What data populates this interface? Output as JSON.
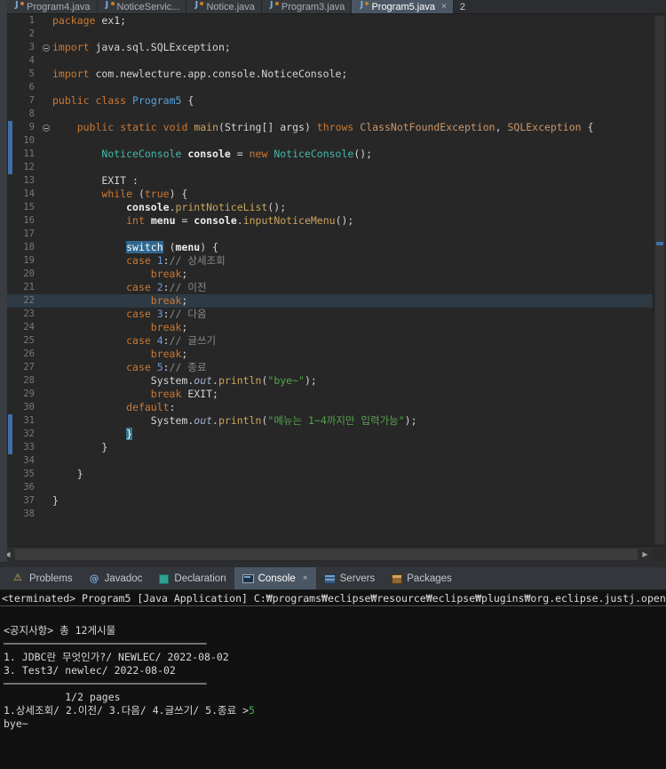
{
  "app": {
    "name": "Eclipse IDE",
    "theme": "dark"
  },
  "editor_tabs": {
    "tabs": [
      {
        "label": "Program4.java",
        "active": false,
        "closable": false
      },
      {
        "label": "NoticeServic...",
        "active": false,
        "closable": false
      },
      {
        "label": "Notice.java",
        "active": false,
        "closable": false
      },
      {
        "label": "Program3.java",
        "active": false,
        "closable": false
      },
      {
        "label": "Program5.java",
        "active": true,
        "closable": true
      }
    ],
    "more_count": "2"
  },
  "editor": {
    "language": "java",
    "lines": [
      {
        "n": 1,
        "s": [
          [
            "package",
            "kw"
          ],
          [
            " ex1;",
            "def"
          ]
        ]
      },
      {
        "n": 2,
        "s": []
      },
      {
        "n": 3,
        "fold": true,
        "s": [
          [
            "import",
            "kw"
          ],
          [
            " java.sql.SQLException;",
            "def"
          ]
        ]
      },
      {
        "n": 4,
        "s": []
      },
      {
        "n": 5,
        "s": [
          [
            "import",
            "kw"
          ],
          [
            " com.newlecture.app.console.NoticeConsole;",
            "def"
          ]
        ]
      },
      {
        "n": 6,
        "s": []
      },
      {
        "n": 7,
        "s": [
          [
            "public",
            "kw"
          ],
          [
            " ",
            "def"
          ],
          [
            "class",
            "kw"
          ],
          [
            " ",
            "def"
          ],
          [
            "Program5",
            "cls"
          ],
          [
            " {",
            "def"
          ]
        ]
      },
      {
        "n": 8,
        "s": []
      },
      {
        "n": 9,
        "fold": true,
        "diff": true,
        "s": [
          [
            "    ",
            "def"
          ],
          [
            "public",
            "kw"
          ],
          [
            " ",
            "def"
          ],
          [
            "static",
            "kw"
          ],
          [
            " ",
            "def"
          ],
          [
            "void",
            "kw"
          ],
          [
            " ",
            "def"
          ],
          [
            "main",
            "mth"
          ],
          [
            "(String[] args) ",
            "def"
          ],
          [
            "throws",
            "kw"
          ],
          [
            " ",
            "def"
          ],
          [
            "ClassNotFoundException",
            "exc"
          ],
          [
            ", ",
            "def"
          ],
          [
            "SQLException",
            "exc"
          ],
          [
            " {",
            "def"
          ]
        ]
      },
      {
        "n": 10,
        "diff": true,
        "s": []
      },
      {
        "n": 11,
        "diff": true,
        "s": [
          [
            "        ",
            "def"
          ],
          [
            "NoticeConsole",
            "cls2"
          ],
          [
            " ",
            "def"
          ],
          [
            "console",
            "var"
          ],
          [
            " = ",
            "def"
          ],
          [
            "new",
            "kw"
          ],
          [
            " ",
            "def"
          ],
          [
            "NoticeConsole",
            "cls2"
          ],
          [
            "();",
            "def"
          ]
        ]
      },
      {
        "n": 12,
        "diff": true,
        "s": []
      },
      {
        "n": 13,
        "s": [
          [
            "        EXIT :",
            "def"
          ]
        ]
      },
      {
        "n": 14,
        "s": [
          [
            "        ",
            "def"
          ],
          [
            "while",
            "kw"
          ],
          [
            " (",
            "def"
          ],
          [
            "true",
            "kw"
          ],
          [
            ") {",
            "def"
          ]
        ]
      },
      {
        "n": 15,
        "s": [
          [
            "            ",
            "def"
          ],
          [
            "console",
            "var"
          ],
          [
            ".",
            "def"
          ],
          [
            "printNoticeList",
            "mth"
          ],
          [
            "();",
            "def"
          ]
        ]
      },
      {
        "n": 16,
        "s": [
          [
            "            ",
            "def"
          ],
          [
            "int",
            "kw"
          ],
          [
            " ",
            "def"
          ],
          [
            "menu",
            "var"
          ],
          [
            " = ",
            "def"
          ],
          [
            "console",
            "var"
          ],
          [
            ".",
            "def"
          ],
          [
            "inputNoticeMenu",
            "mth"
          ],
          [
            "();",
            "def"
          ]
        ]
      },
      {
        "n": 17,
        "s": []
      },
      {
        "n": 18,
        "s": [
          [
            "            ",
            "def"
          ],
          [
            "switch",
            "sel"
          ],
          [
            " (",
            "def"
          ],
          [
            "menu",
            "var"
          ],
          [
            ") {",
            "def"
          ]
        ]
      },
      {
        "n": 19,
        "s": [
          [
            "            ",
            "def"
          ],
          [
            "case",
            "kw"
          ],
          [
            " ",
            "def"
          ],
          [
            "1",
            "lit"
          ],
          [
            ":",
            "def"
          ],
          [
            "// 상세조회",
            "cmt"
          ]
        ]
      },
      {
        "n": 20,
        "s": [
          [
            "                ",
            "def"
          ],
          [
            "break",
            "kw"
          ],
          [
            ";",
            "def"
          ]
        ]
      },
      {
        "n": 21,
        "s": [
          [
            "            ",
            "def"
          ],
          [
            "case",
            "kw"
          ],
          [
            " ",
            "def"
          ],
          [
            "2",
            "lit"
          ],
          [
            ":",
            "def"
          ],
          [
            "// 이전",
            "cmt"
          ]
        ]
      },
      {
        "n": 22,
        "hl": true,
        "s": [
          [
            "                ",
            "def"
          ],
          [
            "break",
            "kw"
          ],
          [
            ";",
            "def"
          ]
        ]
      },
      {
        "n": 23,
        "s": [
          [
            "            ",
            "def"
          ],
          [
            "case",
            "kw"
          ],
          [
            " ",
            "def"
          ],
          [
            "3",
            "lit"
          ],
          [
            ":",
            "def"
          ],
          [
            "// 다음",
            "cmt"
          ]
        ]
      },
      {
        "n": 24,
        "s": [
          [
            "                ",
            "def"
          ],
          [
            "break",
            "kw"
          ],
          [
            ";",
            "def"
          ]
        ]
      },
      {
        "n": 25,
        "s": [
          [
            "            ",
            "def"
          ],
          [
            "case",
            "kw"
          ],
          [
            " ",
            "def"
          ],
          [
            "4",
            "lit"
          ],
          [
            ":",
            "def"
          ],
          [
            "// 글쓰기",
            "cmt"
          ]
        ]
      },
      {
        "n": 26,
        "s": [
          [
            "                ",
            "def"
          ],
          [
            "break",
            "kw"
          ],
          [
            ";",
            "def"
          ]
        ]
      },
      {
        "n": 27,
        "s": [
          [
            "            ",
            "def"
          ],
          [
            "case",
            "kw"
          ],
          [
            " ",
            "def"
          ],
          [
            "5",
            "lit"
          ],
          [
            ":",
            "def"
          ],
          [
            "// 종료",
            "cmt"
          ]
        ]
      },
      {
        "n": 28,
        "s": [
          [
            "                System",
            "def"
          ],
          [
            ".",
            "def"
          ],
          [
            "out",
            "fld"
          ],
          [
            ".",
            "def"
          ],
          [
            "println",
            "mth"
          ],
          [
            "(",
            "def"
          ],
          [
            "\"bye~\"",
            "str"
          ],
          [
            ");",
            "def"
          ]
        ]
      },
      {
        "n": 29,
        "s": [
          [
            "                ",
            "def"
          ],
          [
            "break",
            "kw"
          ],
          [
            " EXIT;",
            "def"
          ]
        ]
      },
      {
        "n": 30,
        "s": [
          [
            "            ",
            "def"
          ],
          [
            "default",
            "kw"
          ],
          [
            ":",
            "def"
          ]
        ]
      },
      {
        "n": 31,
        "diff": true,
        "s": [
          [
            "                System",
            "def"
          ],
          [
            ".",
            "def"
          ],
          [
            "out",
            "fld"
          ],
          [
            ".",
            "def"
          ],
          [
            "println",
            "mth"
          ],
          [
            "(",
            "def"
          ],
          [
            "\"메뉴는 1~4까지만 입력가능\"",
            "str"
          ],
          [
            ");",
            "def"
          ]
        ]
      },
      {
        "n": 32,
        "diff": true,
        "s": [
          [
            "            ",
            "def"
          ],
          [
            "}",
            "brkt"
          ]
        ]
      },
      {
        "n": 33,
        "diff": true,
        "s": [
          [
            "        }",
            "def"
          ]
        ]
      },
      {
        "n": 34,
        "s": []
      },
      {
        "n": 35,
        "s": [
          [
            "    }",
            "def"
          ]
        ]
      },
      {
        "n": 36,
        "s": []
      },
      {
        "n": 37,
        "s": [
          [
            "}",
            "def"
          ]
        ]
      },
      {
        "n": 38,
        "s": []
      }
    ]
  },
  "bottom_tabs": {
    "tabs": [
      {
        "label": "Problems",
        "icon": "problems-icon",
        "active": false,
        "closable": false
      },
      {
        "label": "Javadoc",
        "icon": "javadoc-icon",
        "active": false,
        "closable": false
      },
      {
        "label": "Declaration",
        "icon": "declaration-icon",
        "active": false,
        "closable": false
      },
      {
        "label": "Console",
        "icon": "console-icon",
        "active": true,
        "closable": true
      },
      {
        "label": "Servers",
        "icon": "servers-icon",
        "active": false,
        "closable": false
      },
      {
        "label": "Packages",
        "icon": "packages-icon",
        "active": false,
        "closable": false
      }
    ]
  },
  "console": {
    "status_line": "<terminated> Program5 [Java Application] C:₩programs₩eclipse₩resource₩eclipse₩plugins₩org.eclipse.justj.openjdk.hotspot.jre.full.win",
    "lines": [
      [
        [
          "",
          "out"
        ]
      ],
      [
        [
          "<공지사항> 총 12게시물",
          "out"
        ]
      ],
      [
        [
          "─────────────────────────────────",
          "out"
        ]
      ],
      [
        [
          "1. JDBC란 무엇인가?/ NEWLEC/ 2022-08-02",
          "out"
        ]
      ],
      [
        [
          "3. Test3/ newlec/ 2022-08-02",
          "out"
        ]
      ],
      [
        [
          "─────────────────────────────────",
          "out"
        ]
      ],
      [
        [
          "          1/2 pages",
          "out"
        ]
      ],
      [
        [
          "1.상세조회/ 2.이전/ 3.다음/ 4.글쓰기/ 5.종료 >",
          "out"
        ],
        [
          "5",
          "in"
        ]
      ],
      [
        [
          "bye~",
          "out"
        ]
      ]
    ]
  },
  "colors": {
    "editor_bg": "#272727",
    "panel_bg": "#33363A",
    "tab_active_bg": "#4A5663",
    "keyword": "#CC7832",
    "class_ref": "#58A1D8",
    "type_teal": "#45B8AC",
    "exception": "#CE9668",
    "method": "#C9A55C",
    "variable": "#ECECEC",
    "number": "#6C9CD6",
    "string": "#55A34E",
    "comment": "#8A8A8A",
    "field": "#9FB0D0",
    "default_fg": "#D4D4D4",
    "line_number": "#787878",
    "selection_bg": "#31688F",
    "bracket_match_bg": "#37788A",
    "current_line_bg": "#2E3A44",
    "quickdiff": "#3E6FA8",
    "console_bg": "#111111",
    "console_fg": "#D8D8D8",
    "stdin_green": "#45B045"
  }
}
